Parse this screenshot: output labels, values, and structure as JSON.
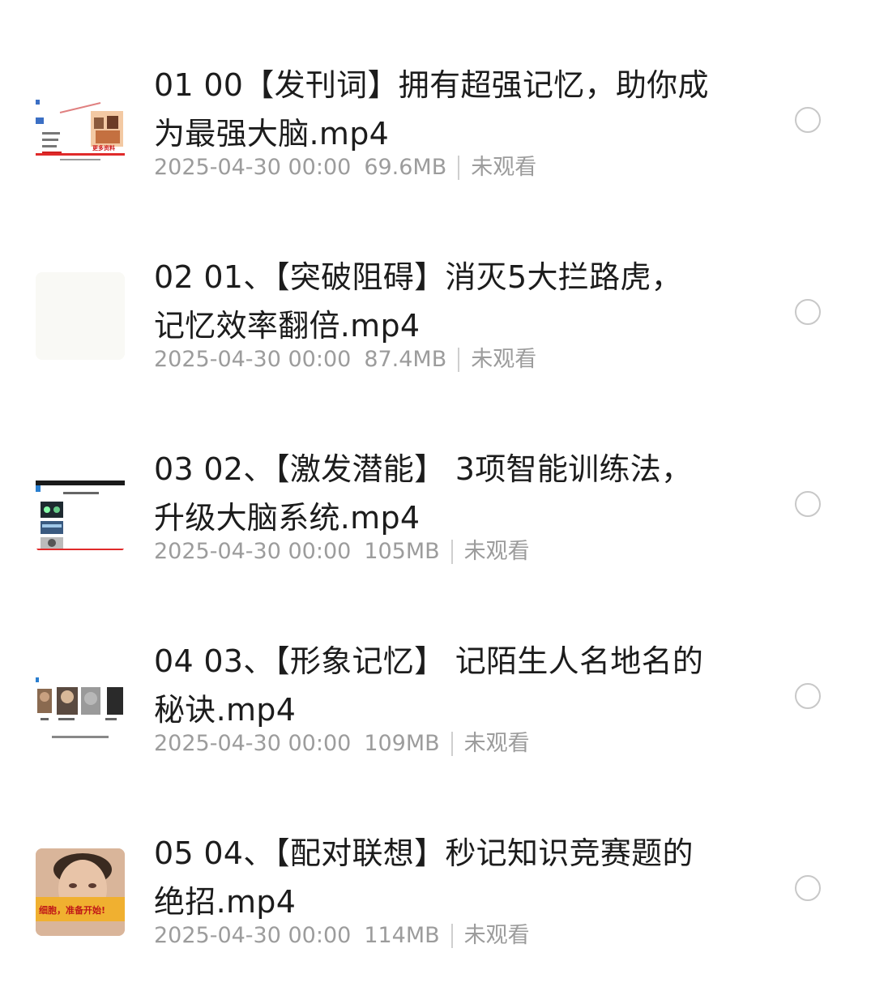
{
  "files": [
    {
      "title": "01 00【发刊词】拥有超强记忆，助你成为最强大脑.mp4",
      "date": "2025-04-30 00:00",
      "size": "69.6MB",
      "status": "未观看",
      "thumb_text": "更多资料"
    },
    {
      "title": "02 01、【突破阻碍】消灭5大拦路虎，记忆效率翻倍.mp4",
      "date": "2025-04-30 00:00",
      "size": "87.4MB",
      "status": "未观看"
    },
    {
      "title": "03 02、【激发潜能】 3项智能训练法，升级大脑系统.mp4",
      "date": "2025-04-30 00:00",
      "size": "105MB",
      "status": "未观看"
    },
    {
      "title": "04 03、【形象记忆】 记陌生人名地名的秘诀.mp4",
      "date": "2025-04-30 00:00",
      "size": "109MB",
      "status": "未观看"
    },
    {
      "title": "05 04、【配对联想】秒记知识竞赛题的绝招.mp4",
      "date": "2025-04-30 00:00",
      "size": "114MB",
      "status": "未观看",
      "thumb_text": "细胞，准备开始!"
    }
  ],
  "colors": {
    "title": "#1c1c1c",
    "meta": "#9c9c9c",
    "radio_border": "#c8c8c8",
    "thumb_accent_red": "#d02020",
    "thumb_banner_orange": "#f0b030"
  }
}
